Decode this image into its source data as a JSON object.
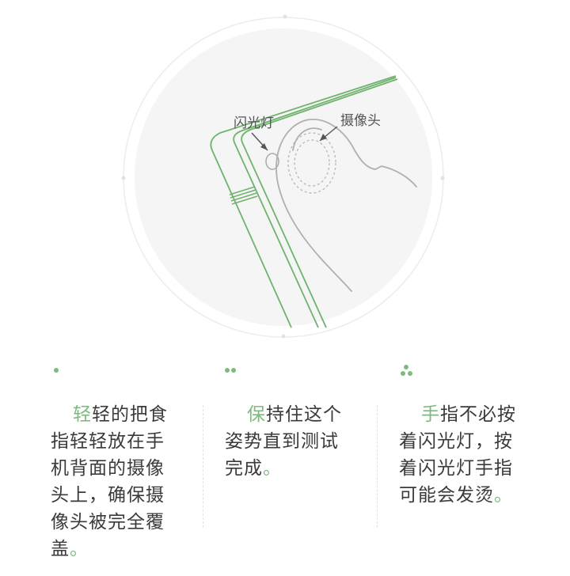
{
  "illustration": {
    "flash_label": "闪光灯",
    "camera_label": "摄像头"
  },
  "colors": {
    "accent": "#7dba7d",
    "phone": "#6fb36f",
    "text": "#3a3a3a"
  },
  "steps": [
    {
      "accent": "轻",
      "text": "轻的把食指轻轻放在手机背面的摄像头上，确保摄像头被完全覆盖",
      "end": "。"
    },
    {
      "accent": "保",
      "text": "持住这个姿势直到测试完成",
      "end": "。"
    },
    {
      "accent": "手",
      "text": "指不必按着闪光灯，按着闪光灯手指可能会发烫",
      "end": "。"
    }
  ]
}
